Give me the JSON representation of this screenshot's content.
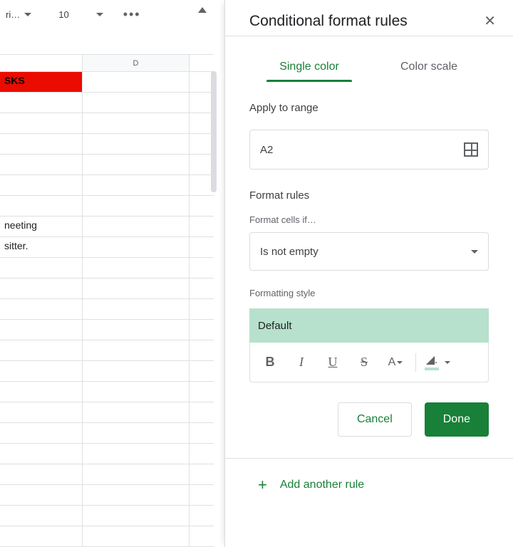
{
  "toolbar": {
    "font_name_trunc": "ri…",
    "font_size": "10"
  },
  "sheet": {
    "col_header_D": "D",
    "rows": [
      "SKS",
      "",
      "",
      "",
      "",
      "",
      "",
      "neeting",
      "sitter.",
      "",
      "",
      "",
      "",
      "",
      "",
      "",
      "",
      "",
      "",
      "",
      "",
      "",
      ""
    ]
  },
  "panel": {
    "title": "Conditional format rules",
    "tabs": {
      "single": "Single color",
      "scale": "Color scale"
    },
    "apply_label": "Apply to range",
    "range_value": "A2",
    "format_rules_label": "Format rules",
    "format_if_label": "Format cells if…",
    "condition_value": "Is not empty",
    "formatting_style_label": "Formatting style",
    "style_preview": "Default",
    "cancel": "Cancel",
    "done": "Done",
    "add_rule": "Add another rule"
  }
}
